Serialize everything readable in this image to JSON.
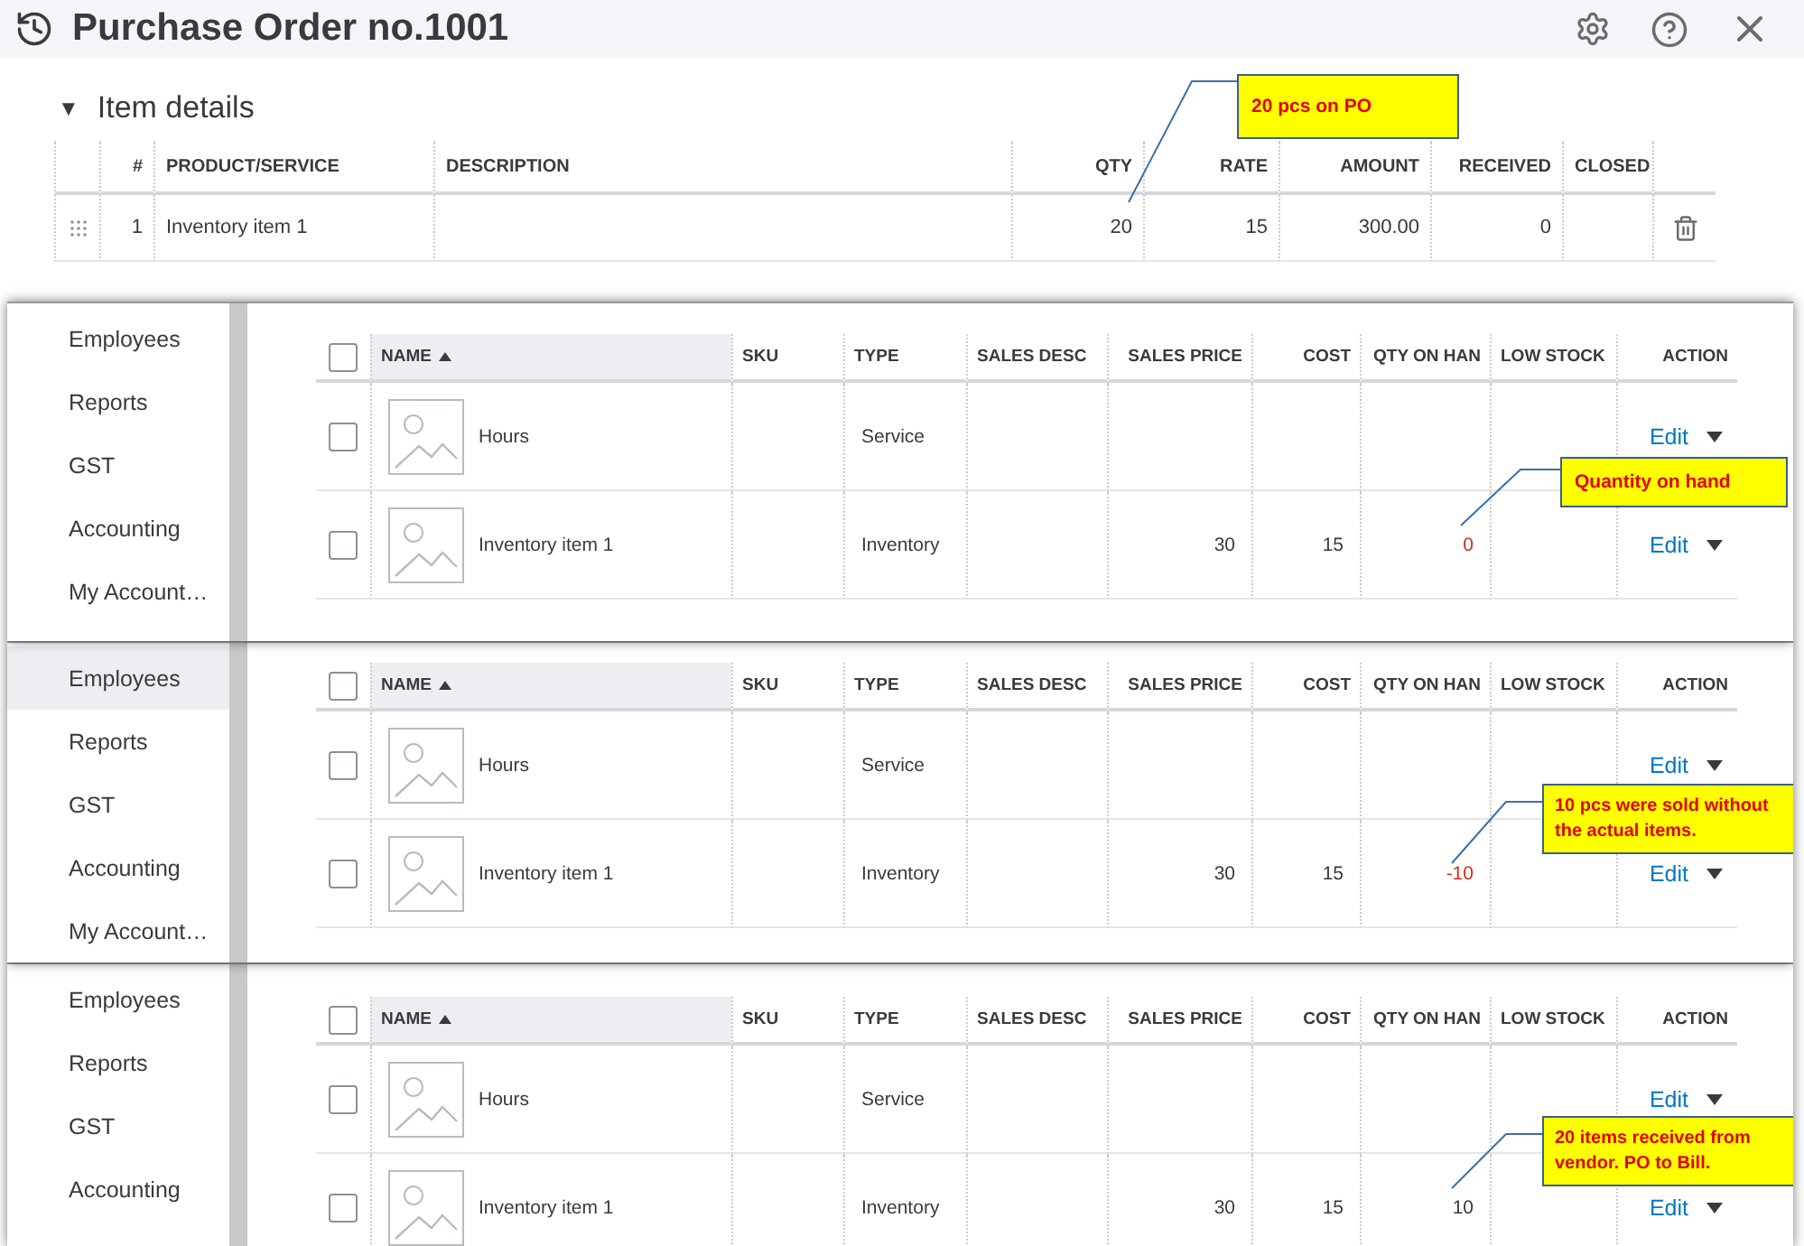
{
  "window": {
    "title": "Purchase Order no.1001"
  },
  "item_details": {
    "toggle": "▼",
    "title": "Item details",
    "columns": [
      "#",
      "PRODUCT/SERVICE",
      "DESCRIPTION",
      "QTY",
      "RATE",
      "AMOUNT",
      "RECEIVED",
      "CLOSED"
    ],
    "rows": [
      {
        "cells": [
          "1",
          "Inventory item 1",
          null,
          "20",
          "15",
          "300.00",
          "0",
          null
        ]
      }
    ],
    "callout": {
      "text": "20 pcs on PO"
    }
  },
  "panels": [
    {
      "sidebar": [
        {
          "label": "Employees",
          "selected": false
        },
        {
          "label": "Reports",
          "selected": false
        },
        {
          "label": "GST",
          "selected": false
        },
        {
          "label": "Accounting",
          "selected": false
        },
        {
          "label": "My Account…",
          "selected": false
        }
      ],
      "columns": [
        {
          "label": "NAME",
          "sorted": true
        },
        {
          "label": "SKU",
          "sorted": false
        },
        {
          "label": "TYPE",
          "sorted": false
        },
        {
          "label": "SALES DESC",
          "sorted": false
        },
        {
          "label": "SALES PRICE",
          "sorted": false
        },
        {
          "label": "COST",
          "sorted": false
        },
        {
          "label": "QTY ON HAN",
          "sorted": false
        },
        {
          "label": "LOW STOCK",
          "sorted": false
        },
        {
          "label": "ACTION",
          "sorted": false
        }
      ],
      "select_all": false,
      "rows": [
        {
          "cells": [
            "Hours",
            null,
            "Service",
            null,
            null,
            null,
            null,
            null
          ],
          "action": "Edit",
          "checked": false
        },
        {
          "cells": [
            "Inventory item 1",
            null,
            "Inventory",
            null,
            "30",
            "15",
            "0",
            null
          ],
          "action": "Edit",
          "checked": false,
          "alert": true
        }
      ],
      "callout": {
        "text": "Quantity on hand"
      }
    },
    {
      "sidebar": [
        {
          "label": "Employees",
          "selected": true
        },
        {
          "label": "Reports",
          "selected": false
        },
        {
          "label": "GST",
          "selected": false
        },
        {
          "label": "Accounting",
          "selected": false
        },
        {
          "label": "My Account…",
          "selected": false
        }
      ],
      "columns": [
        {
          "label": "NAME",
          "sorted": true
        },
        {
          "label": "SKU",
          "sorted": false
        },
        {
          "label": "TYPE",
          "sorted": false
        },
        {
          "label": "SALES DESC",
          "sorted": false
        },
        {
          "label": "SALES PRICE",
          "sorted": false
        },
        {
          "label": "COST",
          "sorted": false
        },
        {
          "label": "QTY ON HAN",
          "sorted": false
        },
        {
          "label": "LOW STOCK",
          "sorted": false
        },
        {
          "label": "ACTION",
          "sorted": false
        }
      ],
      "select_all": false,
      "rows": [
        {
          "cells": [
            "Hours",
            null,
            "Service",
            null,
            null,
            null,
            null,
            null
          ],
          "action": "Edit",
          "checked": false
        },
        {
          "cells": [
            "Inventory item 1",
            null,
            "Inventory",
            null,
            "30",
            "15",
            "-10",
            null
          ],
          "action": "Edit",
          "checked": false,
          "alert": true
        }
      ],
      "callout": {
        "text": "10 pcs were sold without the actual items."
      }
    },
    {
      "sidebar": [
        {
          "label": "Employees",
          "selected": false
        },
        {
          "label": "Reports",
          "selected": false
        },
        {
          "label": "GST",
          "selected": false
        },
        {
          "label": "Accounting",
          "selected": false
        }
      ],
      "columns": [
        {
          "label": "NAME",
          "sorted": true
        },
        {
          "label": "SKU",
          "sorted": false
        },
        {
          "label": "TYPE",
          "sorted": false
        },
        {
          "label": "SALES DESC",
          "sorted": false
        },
        {
          "label": "SALES PRICE",
          "sorted": false
        },
        {
          "label": "COST",
          "sorted": false
        },
        {
          "label": "QTY ON HAN",
          "sorted": false
        },
        {
          "label": "LOW STOCK",
          "sorted": false
        },
        {
          "label": "ACTION",
          "sorted": false
        }
      ],
      "select_all": false,
      "rows": [
        {
          "cells": [
            "Hours",
            null,
            "Service",
            null,
            null,
            null,
            null,
            null
          ],
          "action": "Edit",
          "checked": false
        },
        {
          "cells": [
            "Inventory item 1",
            null,
            "Inventory",
            null,
            "30",
            "15",
            "10",
            null
          ],
          "action": "Edit",
          "checked": false,
          "alert": false
        }
      ],
      "callout": {
        "text": "20 items received from vendor. PO to Bill."
      }
    }
  ]
}
